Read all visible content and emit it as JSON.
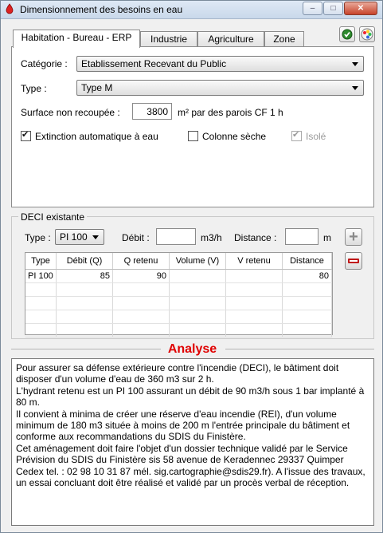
{
  "window": {
    "title": "Dimensionnement des besoins en eau",
    "minimize": "–",
    "maximize": "□",
    "close": "✕"
  },
  "tabs": [
    "Habitation - Bureau - ERP",
    "Industrie",
    "Agriculture",
    "Zone"
  ],
  "toolbar_icons": {
    "validate": "validate-icon",
    "palette": "palette-icon"
  },
  "form": {
    "categorie_label": "Catégorie :",
    "categorie_value": "Etablissement Recevant du Public",
    "type_label": "Type :",
    "type_value": "Type M",
    "surface_label": "Surface non recoupée :",
    "surface_value": "3800",
    "surface_unit": "m² par des parois CF 1 h",
    "extinction_label": "Extinction automatique à eau",
    "extinction_checked": true,
    "colonne_label": "Colonne sèche",
    "colonne_checked": false,
    "isole_label": "Isolé",
    "isole_checked": true
  },
  "deci": {
    "group_label": "DECI existante",
    "type_label": "Type :",
    "type_value": "PI 100",
    "debit_label": "Débit :",
    "debit_value": "",
    "debit_unit": "m3/h",
    "distance_label": "Distance :",
    "distance_value": "",
    "distance_unit": "m",
    "add_button": "+",
    "remove_button": "−",
    "columns": [
      "Type",
      "Débit (Q)",
      "Q retenu",
      "Volume (V)",
      "V retenu",
      "Distance"
    ],
    "rows": [
      [
        "PI 100",
        "85",
        "90",
        "",
        "",
        "80"
      ]
    ]
  },
  "analyse": {
    "title": "Analyse",
    "paragraphs": [
      "Pour assurer sa défense extérieure contre l'incendie (DECI), le bâtiment doit disposer d'un volume d'eau de 360 m3 sur 2 h.",
      "L'hydrant retenu est un PI 100 assurant un débit de 90 m3/h sous 1 bar implanté à 80 m.",
      "Il convient à minima de créer une réserve d'eau incendie (REI), d'un volume minimum de 180 m3 située à moins de 200 m l'entrée principale du bâtiment et conforme aux recommandations du SDIS du Finistère.",
      "Cet aménagement doit faire l'objet d'un dossier technique validé par le Service Prévision du SDIS du Finistère sis 58 avenue de Keradennec 29337 Quimper Cedex tel. : 02 98 10 31 87 mél. sig.cartographie@sdis29.fr). A l'issue des travaux, un essai concluant doit être réalisé et validé par un procès verbal de réception."
    ]
  },
  "colors": {
    "analyse_title": "#e00000",
    "add": "#8a8a8a",
    "remove": "#c01818"
  }
}
